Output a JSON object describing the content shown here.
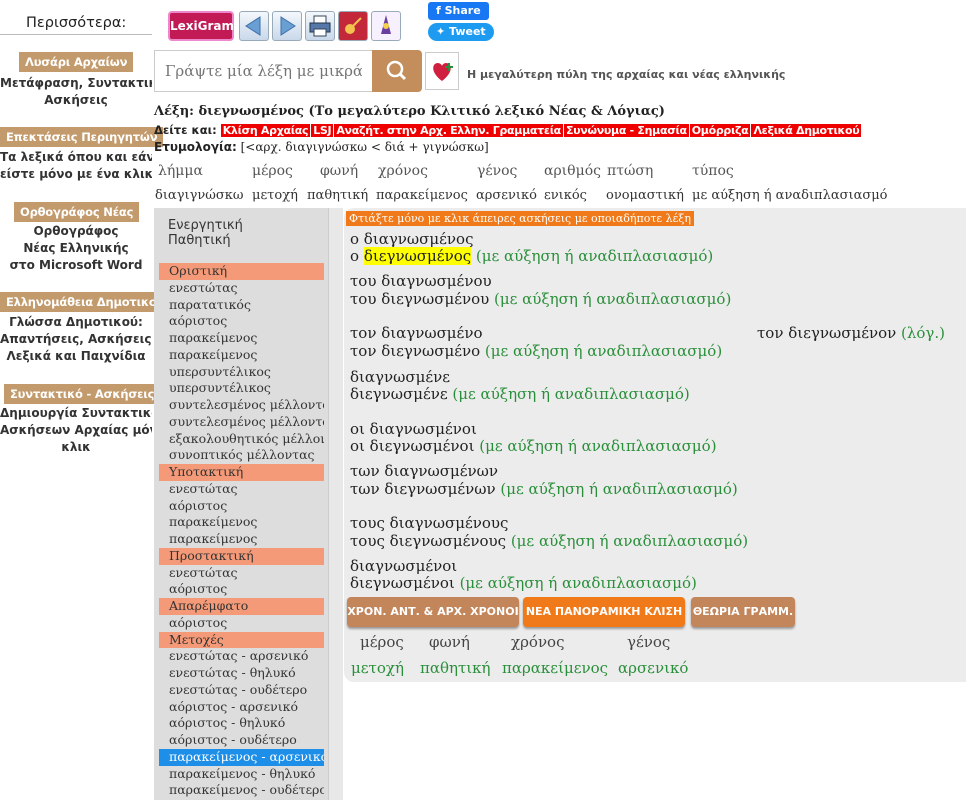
{
  "sidebar": {
    "heading": "Περισσότερα:",
    "blocks": [
      {
        "button": "Λυσάρι Αρχαίων",
        "desc1": "Μετάφραση, Συντακτικό,",
        "desc2": "Ασκήσεις",
        "desc3": ""
      },
      {
        "button": "Επεκτάσεις Περιηγητών",
        "desc1": "Τα λεξικά όπου και εάν",
        "desc2": "είστε μόνο με ένα κλικ",
        "desc3": ""
      },
      {
        "button": "Ορθογράφος Νέας",
        "desc1": "Ορθογράφος",
        "desc2": "Νέας Ελληνικής",
        "desc3": "στο Microsoft Word"
      },
      {
        "button": "Ελληνομάθεια Δημοτικού",
        "desc1": "Γλώσσα Δημοτικού:",
        "desc2": "Απαντήσεις, Ασκήσεις,",
        "desc3": "Λεξικά και Παιχνίδια"
      },
      {
        "button": "Συντακτικό - Ασκήσεις",
        "desc1": "Δημιουργία Συντακτικού και",
        "desc2": "Ασκήσεων Αρχαίας μόνο με",
        "desc3": "κλικ"
      }
    ]
  },
  "toolbar": {
    "logo": "LexiGram",
    "share": "Share",
    "tweet": "Tweet"
  },
  "search": {
    "placeholder": "Γράψτε μία λέξη με μικρά",
    "tagline": "Η μεγαλύτερη πύλη της αρχαίας και νέας ελληνικής"
  },
  "word": {
    "label": "Λέξη:",
    "value": "διεγνωσμένος (Το μεγαλύτερο Κλιτικό λεξικό Νέας & Λόγιας)",
    "see_label": "Δείτε και:",
    "links": [
      "Κλίση Αρχαίας",
      "LSJ",
      "Αναζήτ. στην Αρχ. Ελλην. Γραμματεία",
      "Συνώνυμα - Σημασία",
      "Ομόρριζα",
      "Λεξικά Δημοτικού"
    ],
    "etym_label": "Ετυμολογία:",
    "etym_value": "[<αρχ. διαγιγνώσκω < διά + γιγνώσκω]"
  },
  "grammar_table": {
    "headers": [
      "λήμμα",
      "μέρος",
      "φωνή",
      "χρόνος",
      "γένος",
      "αριθμός",
      "πτώση",
      "τύπος"
    ],
    "values": [
      "διαγιγνώσκω",
      "μετοχή",
      "παθητική",
      "παρακείμενος",
      "αρσενικό",
      "ενικός",
      "ονομαστική",
      "με αύξηση ή αναδιπλασιασμό"
    ]
  },
  "voices": [
    "Ενεργητική",
    "Παθητική"
  ],
  "tenses": [
    {
      "label": "Οριστική",
      "type": "head"
    },
    {
      "label": "ενεστώτας",
      "type": "item"
    },
    {
      "label": "παρατατικός",
      "type": "item"
    },
    {
      "label": "αόριστος",
      "type": "item"
    },
    {
      "label": "παρακείμενος",
      "type": "item"
    },
    {
      "label": "παρακείμενος",
      "type": "item"
    },
    {
      "label": "υπερσυντέλικος",
      "type": "item"
    },
    {
      "label": "υπερσυντέλικος",
      "type": "item"
    },
    {
      "label": "συντελεσμένος μέλλοντας",
      "type": "item"
    },
    {
      "label": "συντελεσμένος μέλλοντας",
      "type": "item"
    },
    {
      "label": "εξακολουθητικός μέλλοντας",
      "type": "item"
    },
    {
      "label": "συνοπτικός μέλλοντας",
      "type": "item"
    },
    {
      "label": "Υποτακτική",
      "type": "head"
    },
    {
      "label": "ενεστώτας",
      "type": "item"
    },
    {
      "label": "αόριστος",
      "type": "item"
    },
    {
      "label": "παρακείμενος",
      "type": "item"
    },
    {
      "label": "παρακείμενος",
      "type": "item"
    },
    {
      "label": "Προστακτική",
      "type": "head"
    },
    {
      "label": "ενεστώτας",
      "type": "item"
    },
    {
      "label": "αόριστος",
      "type": "item"
    },
    {
      "label": "Απαρέμφατο",
      "type": "head"
    },
    {
      "label": "αόριστος",
      "type": "item"
    },
    {
      "label": "Μετοχές",
      "type": "head"
    },
    {
      "label": "ενεστώτας - αρσενικό",
      "type": "item"
    },
    {
      "label": "ενεστώτας - θηλυκό",
      "type": "item"
    },
    {
      "label": "ενεστώτας - ουδέτερο",
      "type": "item"
    },
    {
      "label": "αόριστος - αρσενικό",
      "type": "item"
    },
    {
      "label": "αόριστος - θηλυκό",
      "type": "item"
    },
    {
      "label": "αόριστος - ουδέτερο",
      "type": "item"
    },
    {
      "label": "παρακείμενος - αρσενικό",
      "type": "sel"
    },
    {
      "label": "παρακείμενος - θηλυκό",
      "type": "item"
    },
    {
      "label": "παρακείμενος - ουδέτερο",
      "type": "item"
    }
  ],
  "forms": {
    "banner": "Φτιάξτε μόνο με κλικ άπειρες ασκήσεις με οποιαδήποτε λέξη",
    "aug": "(με αύξηση ή αναδιπλασιασμό)",
    "lines": [
      {
        "a": "ο διαγνωσμένος"
      },
      {
        "a": "ο ",
        "hl": "διεγνωσμένος",
        "tail": " ",
        "aug": true
      },
      {
        "a": "του διαγνωσμένου"
      },
      {
        "a": "του διεγνωσμένου ",
        "aug": true
      },
      {
        "a": "τον διαγνωσμένο",
        "right": "τον διεγνωσμένον ",
        "right_g": "(λόγ.)"
      },
      {
        "a": "τον διεγνωσμένο ",
        "aug": true
      },
      {
        "a": "διαγνωσμένε"
      },
      {
        "a": "διεγνωσμένε ",
        "aug": true
      },
      {
        "a": "οι διαγνωσμένοι"
      },
      {
        "a": "οι διεγνωσμένοι ",
        "aug": true
      },
      {
        "a": "των διαγνωσμένων"
      },
      {
        "a": "των διεγνωσμένων ",
        "aug": true
      },
      {
        "a": "τους διαγνωσμένους"
      },
      {
        "a": "τους διεγνωσμένους ",
        "aug": true
      },
      {
        "a": "διαγνωσμένοι"
      },
      {
        "a": "διεγνωσμένοι ",
        "aug": true
      }
    ],
    "buttons": [
      "ΧΡΟΝ. ΑΝΤ. & ΑΡΧ. ΧΡΟΝΟΙ",
      "ΝΕΑ ΠΑΝΟΡΑΜΙΚΗ ΚΛΙΣΗ",
      "ΘΕΩΡΙΑ ΓΡΑΜΜ."
    ],
    "button_colors": [
      "#c3855a",
      "#f07a1a",
      "#c3855a"
    ],
    "summary_headers": [
      "μέρος",
      "φωνή",
      "χρόνος",
      "γένος"
    ],
    "summary_values": [
      "μετοχή",
      "παθητική",
      "παρακείμενος",
      "αρσενικό"
    ]
  }
}
